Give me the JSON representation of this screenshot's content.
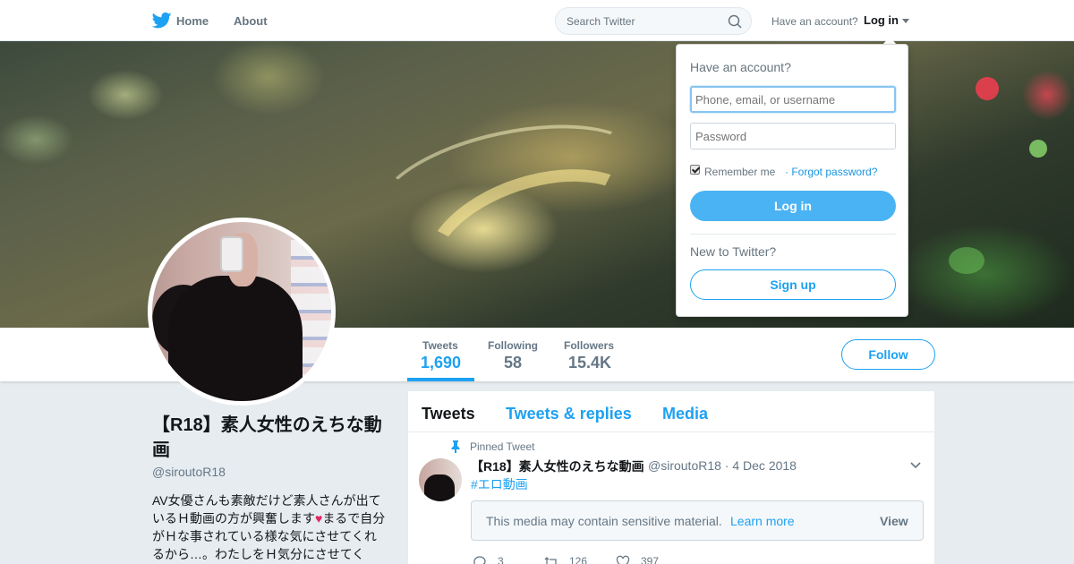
{
  "nav": {
    "home_label": "Home",
    "about_label": "About",
    "search_placeholder": "Search Twitter",
    "have_account": "Have an account?",
    "login_label": "Log in"
  },
  "login_dropdown": {
    "title": "Have an account?",
    "username_placeholder": "Phone, email, or username",
    "password_placeholder": "Password",
    "remember_me": "Remember me",
    "remember_checked": true,
    "forgot_password": "· Forgot password?",
    "login_button": "Log in",
    "new_to_twitter": "New to Twitter?",
    "signup_button": "Sign up"
  },
  "profile": {
    "name": "【R18】素人女性のえちな動画",
    "handle": "@siroutoR18",
    "bio": "AV女優さんも素敵だけど素人さんが出ているＨ動画の方が興奮します",
    "bio_heart": "♥",
    "bio_continued": "まるで自分がＨな事されている様な気にさせてくれるから…。わたしをＨ気分にさせてく"
  },
  "stats": [
    {
      "label": "Tweets",
      "value": "1,690",
      "active": true
    },
    {
      "label": "Following",
      "value": "58",
      "active": false
    },
    {
      "label": "Followers",
      "value": "15.4K",
      "active": false
    }
  ],
  "follow_button": "Follow",
  "timeline": {
    "tabs": [
      "Tweets",
      "Tweets & replies",
      "Media"
    ],
    "active_tab": "Tweets",
    "pinned_label": "Pinned Tweet",
    "tweet": {
      "author": "【R18】素人女性のえちな動画",
      "meta": "@siroutoR18 · 4 Dec 2018",
      "hashtag": "#エロ動画",
      "sensitive_text": "This media may contain sensitive material.",
      "learn_more": "Learn more",
      "view_label": "View",
      "replies": "3",
      "retweets": "126",
      "likes": "397"
    }
  },
  "colors": {
    "accent": "#1da1f2",
    "button_fill": "#4ab3f4",
    "heart": "#e0245e"
  },
  "icons": [
    "twitter-bird-icon",
    "search-icon",
    "caret-down-icon",
    "pin-icon",
    "chevron-down-icon",
    "reply-icon",
    "retweet-icon",
    "like-icon"
  ]
}
